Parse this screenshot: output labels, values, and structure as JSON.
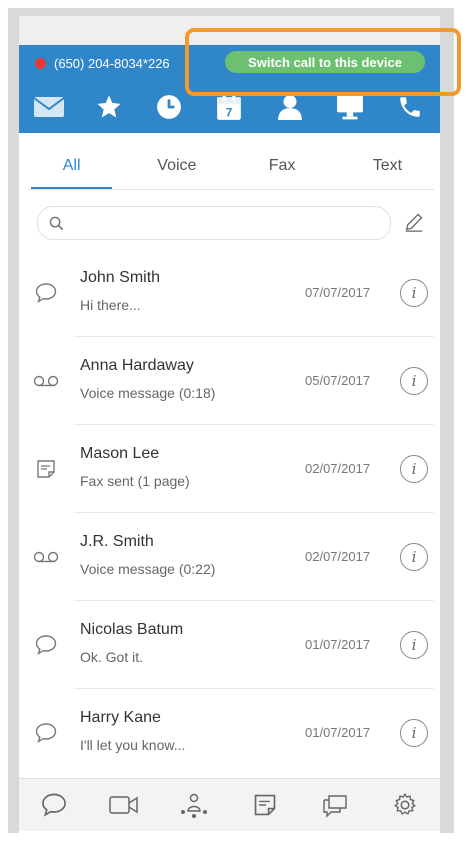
{
  "call_bar": {
    "phone_number": "(650) 204-8034*226",
    "switch_label": "Switch call to this device",
    "colors": {
      "bar": "#2f86c9",
      "button": "#6cc070",
      "indicator": "#e53935"
    }
  },
  "icon_bar": {
    "items": [
      "mail-icon",
      "star-icon",
      "clock-icon",
      "calendar-icon",
      "contacts-icon",
      "monitor-icon",
      "phone-icon"
    ],
    "calendar_day": "7"
  },
  "tabs": [
    {
      "label": "All",
      "active": true
    },
    {
      "label": "Voice",
      "active": false
    },
    {
      "label": "Fax",
      "active": false
    },
    {
      "label": "Text",
      "active": false
    }
  ],
  "search": {
    "placeholder": "",
    "value": ""
  },
  "messages": [
    {
      "type": "text-message-icon",
      "name": "John Smith",
      "preview": "Hi there...",
      "date": "07/07/2017"
    },
    {
      "type": "voicemail-icon",
      "name": "Anna Hardaway",
      "preview": "Voice message (0:18)",
      "date": "05/07/2017"
    },
    {
      "type": "fax-icon",
      "name": "Mason Lee",
      "preview": "Fax sent (1 page)",
      "date": "02/07/2017"
    },
    {
      "type": "voicemail-icon",
      "name": "J.R. Smith",
      "preview": "Voice message (0:22)",
      "date": "02/07/2017"
    },
    {
      "type": "text-message-icon",
      "name": "Nicolas Batum",
      "preview": "Ok. Got it.",
      "date": "01/07/2017"
    },
    {
      "type": "text-message-icon",
      "name": "Harry Kane",
      "preview": "I'll let you know...",
      "date": "01/07/2017"
    }
  ],
  "info_glyph": "i",
  "bottom_nav": [
    "messages-icon",
    "video-icon",
    "conference-icon",
    "fax-icon",
    "chat-icon",
    "settings-icon"
  ],
  "highlight_color": "#f39a2e"
}
